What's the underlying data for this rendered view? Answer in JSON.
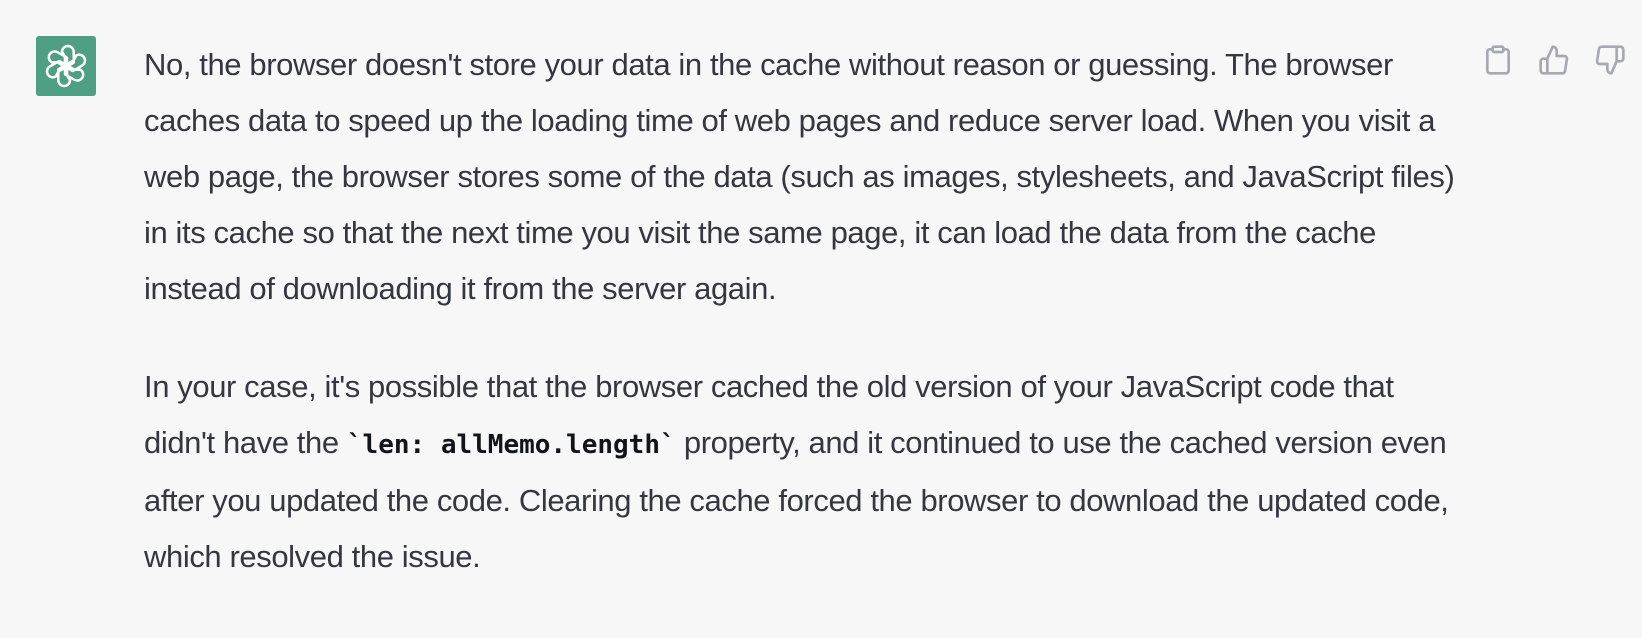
{
  "colors": {
    "background": "#f7f7f8",
    "avatar_bg": "#4e9f84",
    "text": "#353740",
    "icon": "#a7a9b0"
  },
  "message": {
    "avatar_icon": "openai-logo-icon",
    "paragraph1": "No, the browser doesn't store your data in the cache without reason or guessing. The browser caches data to speed up the loading time of web pages and reduce server load. When you visit a web page, the browser stores some of the data (such as images, stylesheets, and JavaScript files) in its cache so that the next time you visit the same page, it can load the data from the cache instead of downloading it from the server again.",
    "paragraph2_before": "In your case, it's possible that the browser cached the old version of your JavaScript code that didn't have the ",
    "paragraph2_code": "`len: allMemo.length`",
    "paragraph2_after": " property, and it continued to use the cached version even after you updated the code. Clearing the cache forced the browser to download the updated code, which resolved the issue."
  },
  "actions": {
    "copy_icon": "clipboard-icon",
    "like_icon": "thumbs-up-icon",
    "dislike_icon": "thumbs-down-icon"
  }
}
